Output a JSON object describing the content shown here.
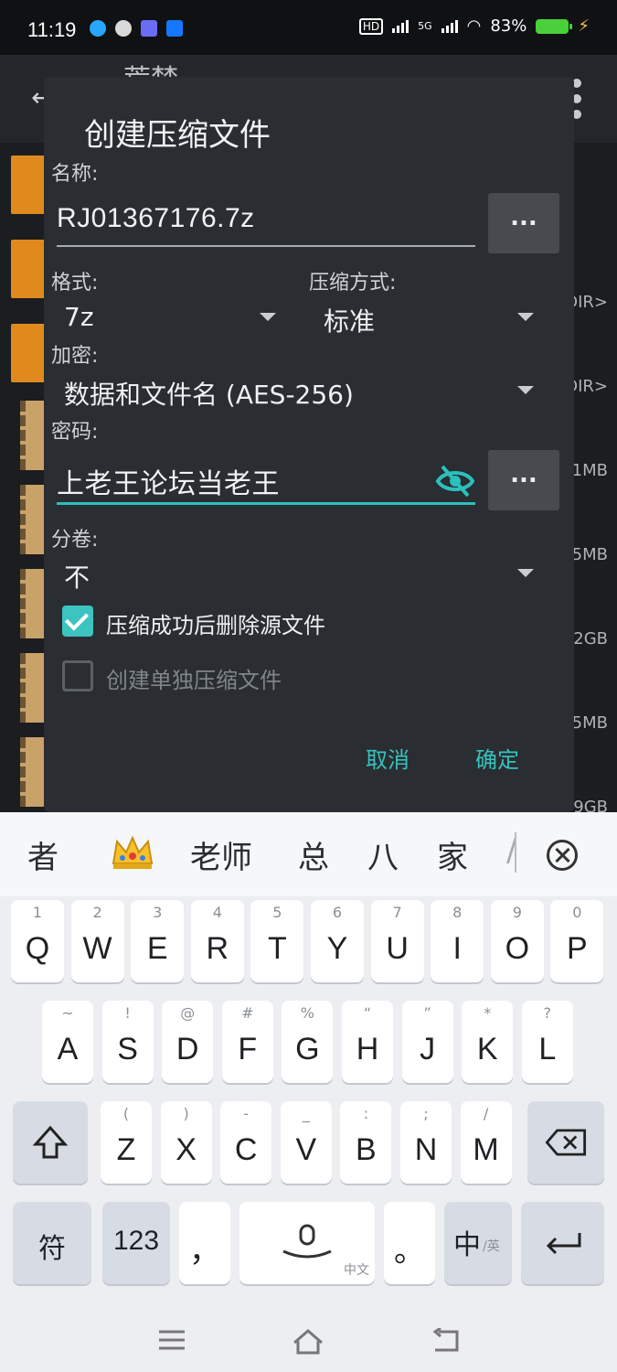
{
  "status_bar": {
    "time": "11:19",
    "battery": "83%",
    "network": "5G"
  },
  "background_app": {
    "title": "荒梦",
    "row_meta": [
      "DIR>",
      "DIR>",
      "1MB",
      "5MB",
      "2GB",
      "5MB",
      "9GB"
    ]
  },
  "dialog": {
    "title": "创建压缩文件",
    "name_label": "名称:",
    "name_value": "RJ01367176.7z",
    "browse_label": "...",
    "format_label": "格式:",
    "format_value": "7z",
    "method_label": "压缩方式:",
    "method_value": "标准",
    "encryption_label": "加密:",
    "encryption_value": "数据和文件名 (AES-256)",
    "password_label": "密码:",
    "password_value": "上老王论坛当老王",
    "password_btn": "...",
    "split_label": "分卷:",
    "split_value": "不",
    "delete_source_label": "压缩成功后删除源文件",
    "delete_source_checked": true,
    "separate_label": "创建单独压缩文件",
    "separate_checked": false,
    "cancel": "取消",
    "ok": "确定",
    "accent_color": "#36c2bd"
  },
  "keyboard": {
    "candidates": [
      "者",
      "老师",
      "总",
      "八",
      "家",
      "/"
    ],
    "row1": [
      {
        "sub": "1",
        "key": "Q"
      },
      {
        "sub": "2",
        "key": "W"
      },
      {
        "sub": "3",
        "key": "E"
      },
      {
        "sub": "4",
        "key": "R"
      },
      {
        "sub": "5",
        "key": "T"
      },
      {
        "sub": "6",
        "key": "Y"
      },
      {
        "sub": "7",
        "key": "U"
      },
      {
        "sub": "8",
        "key": "I"
      },
      {
        "sub": "9",
        "key": "O"
      },
      {
        "sub": "0",
        "key": "P"
      }
    ],
    "row2": [
      {
        "sub": "~",
        "key": "A"
      },
      {
        "sub": "!",
        "key": "S"
      },
      {
        "sub": "@",
        "key": "D"
      },
      {
        "sub": "#",
        "key": "F"
      },
      {
        "sub": "%",
        "key": "G"
      },
      {
        "sub": "“",
        "key": "H"
      },
      {
        "sub": "”",
        "key": "J"
      },
      {
        "sub": "*",
        "key": "K"
      },
      {
        "sub": "?",
        "key": "L"
      }
    ],
    "row3": [
      {
        "sub": "(",
        "key": "Z"
      },
      {
        "sub": ")",
        "key": "X"
      },
      {
        "sub": "-",
        "key": "C"
      },
      {
        "sub": "_",
        "key": "V"
      },
      {
        "sub": ":",
        "key": "B"
      },
      {
        "sub": ";",
        "key": "N"
      },
      {
        "sub": "/",
        "key": "M"
      }
    ],
    "symbols_key": "符",
    "numbers_key": "123",
    "comma_key": "，",
    "space_sub": "中文",
    "period_key": "。",
    "lang_key": "中",
    "lang_sub": "/英"
  }
}
